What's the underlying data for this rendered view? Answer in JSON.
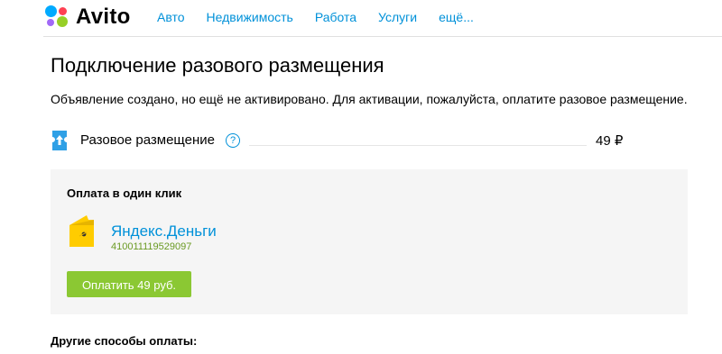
{
  "header": {
    "logo_text": "Avito",
    "nav": [
      "Авто",
      "Недвижимость",
      "Работа",
      "Услуги",
      "ещё..."
    ]
  },
  "page": {
    "title": "Подключение разового размещения",
    "notice": "Объявление создано, но ещё не активировано. Для активации, пожалуйста, оплатите разовое размещение."
  },
  "service": {
    "label": "Разовое размещение",
    "help": "?",
    "price": "49 ₽"
  },
  "one_click": {
    "title": "Оплата в один клик",
    "method_name": "Яндекс.Деньги",
    "account": "410011119529097",
    "pay_button": "Оплатить 49 руб."
  },
  "other_methods": "Другие способы оплаты:",
  "colors": {
    "link": "#0091d9",
    "button": "#8bc833",
    "panel_bg": "#f5f5f5",
    "account_text": "#6a9a23",
    "wallet": "#ffcc00"
  }
}
